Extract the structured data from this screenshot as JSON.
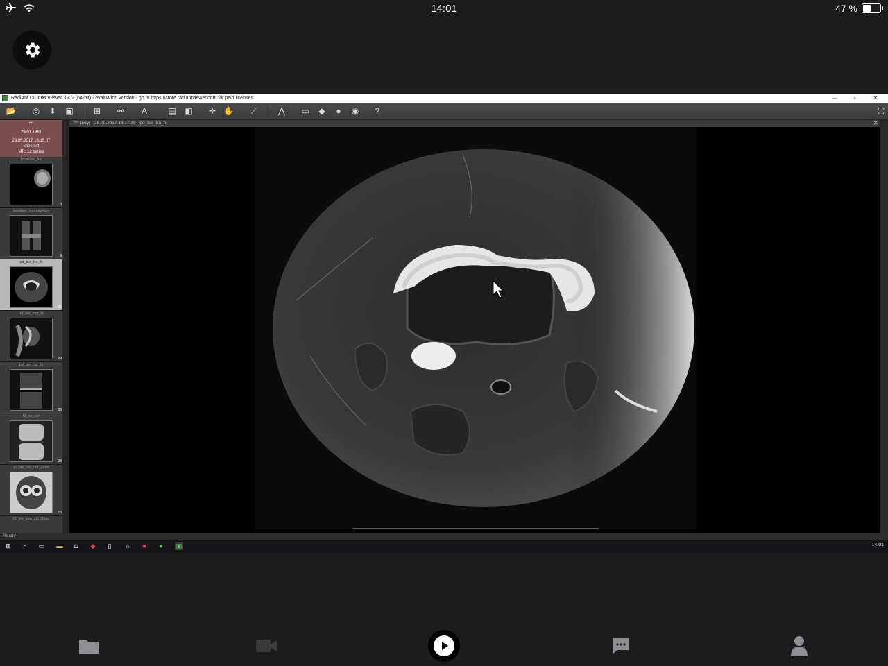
{
  "status_bar": {
    "time": "14:01",
    "battery": "47 %"
  },
  "remote": {
    "window_title": "RadiAnt DICOM Viewer 3.4.2 (64-bit) - evaluation version - go to https://store.radiantviewer.com for paid licenses",
    "study": {
      "name": "***",
      "dob": "29.01.1961",
      "date": "28.05.2017 16:15:07",
      "description": "knee left",
      "modality_series": "MR: 12 series"
    },
    "series": [
      {
        "label": "localizer_tra",
        "count": "3"
      },
      {
        "label": "localizer_tra+sag+cor",
        "count": "9"
      },
      {
        "label": "pd_tse_tra_fs",
        "count": "35"
      },
      {
        "label": "pd_tse_sag_fs",
        "count": "29"
      },
      {
        "label": "pd_tse_cor_fs",
        "count": "28"
      },
      {
        "label": "t1_se_cor",
        "count": "28"
      },
      {
        "label": "t2_tse_cor_cbl_2mm",
        "count": "13"
      },
      {
        "label": "t2_tse_sag_cbl_2mm",
        "count": ""
      }
    ],
    "viewer_header": "*** (56y) - 28.05.2017 16:17:39 - pd_tse_tra_fs",
    "status": "Ready",
    "taskbar_clock": "14:01"
  },
  "tabs": [
    "files",
    "video",
    "play",
    "chat",
    "profile"
  ],
  "colors": {
    "background": "#1c1c1e",
    "study_header": "#7b4d4d"
  }
}
